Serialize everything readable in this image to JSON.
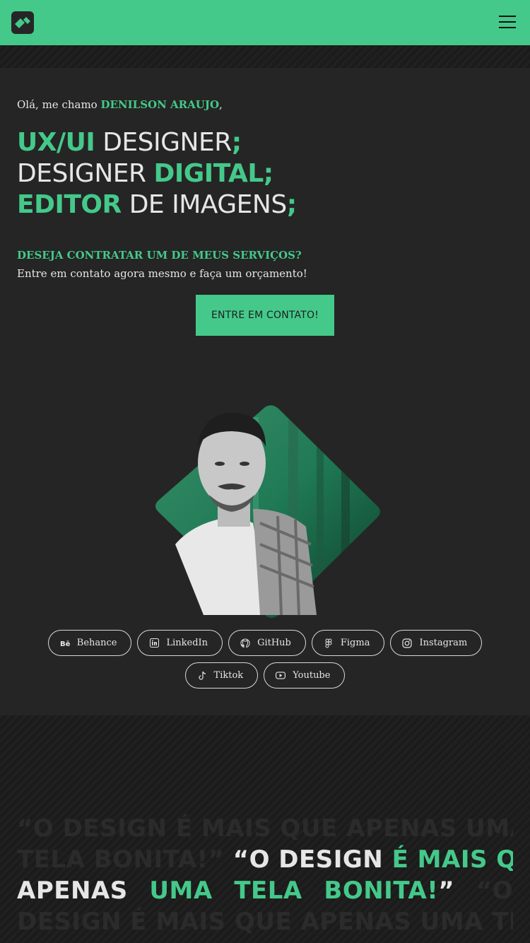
{
  "header": {
    "logo_icon": "diamond-logo-icon",
    "menu_icon": "hamburger-menu-icon",
    "accent": "#44c98a"
  },
  "hero": {
    "greeting_prefix": "Olá, me chamo",
    "name": "DENILSON ARAUJO",
    "greeting_suffix": ",",
    "roles": [
      {
        "highlight": "UX/UI",
        "rest": " DESIGNER",
        "end": ";"
      },
      {
        "rest": "DESIGNER ",
        "highlight": "DIGITAL",
        "end": ";"
      },
      {
        "highlight": "EDITOR",
        "rest": " DE IMAGENS",
        "end": ";"
      }
    ],
    "cta_question": "DESEJA CONTRATAR UM DE MEUS SERVIÇOS?",
    "cta_text": "Entre em contato agora mesmo e faça um orçamento!",
    "cta_button": "ENTRE EM CONTATO!"
  },
  "socials": [
    {
      "label": "Behance",
      "icon": "behance-icon"
    },
    {
      "label": "LinkedIn",
      "icon": "linkedin-icon"
    },
    {
      "label": "GitHub",
      "icon": "github-icon"
    },
    {
      "label": "Figma",
      "icon": "figma-icon"
    },
    {
      "label": "Instagram",
      "icon": "instagram-icon"
    },
    {
      "label": "Tiktok",
      "icon": "tiktok-icon"
    },
    {
      "label": "Youtube",
      "icon": "youtube-icon"
    }
  ],
  "quote": {
    "line1_dim": "“O DESIGN É MAIS QUE APENAS UMA",
    "line2_dim": "TELA BONITA!”",
    "line2_w": "“O DESIGN",
    "line2_g": "É MAIS QUE",
    "line3_w1": "APENAS",
    "line3_g1": "UMA",
    "line3_g2": "TELA",
    "line3_g3": "BONITA!",
    "line3_w2": "”",
    "line3_dim": "“O",
    "line4_dim": "DESIGN É MAIS QUE APENAS UMA TELA"
  }
}
